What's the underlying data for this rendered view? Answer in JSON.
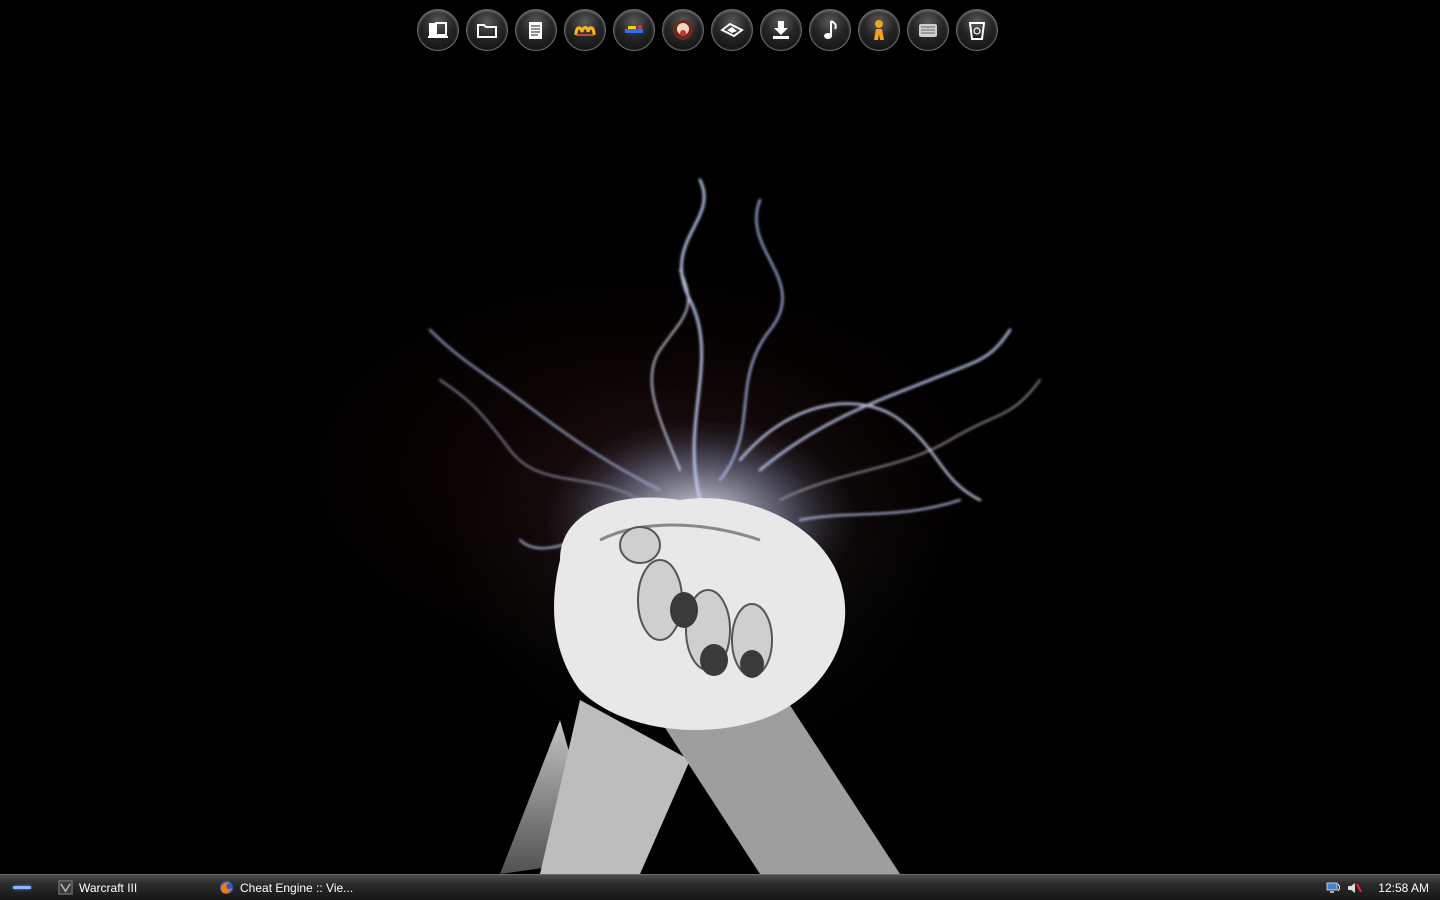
{
  "dock": {
    "items": [
      {
        "name": "library-icon"
      },
      {
        "name": "folder-icon"
      },
      {
        "name": "documents-icon"
      },
      {
        "name": "messenger-icon"
      },
      {
        "name": "toolkit-icon"
      },
      {
        "name": "game-icon"
      },
      {
        "name": "photos-icon"
      },
      {
        "name": "downloads-icon"
      },
      {
        "name": "music-icon"
      },
      {
        "name": "chat-icon"
      },
      {
        "name": "notes-icon"
      },
      {
        "name": "recycle-bin-icon"
      }
    ]
  },
  "taskbar": {
    "tasks": [
      {
        "label": "Warcraft III",
        "icon": "warcraft-icon"
      },
      {
        "label": "Cheat Engine :: Vie...",
        "icon": "firefox-icon"
      }
    ],
    "tray_icons": [
      "network-icon",
      "volume-muted-icon"
    ],
    "clock": "12:58 AM"
  }
}
